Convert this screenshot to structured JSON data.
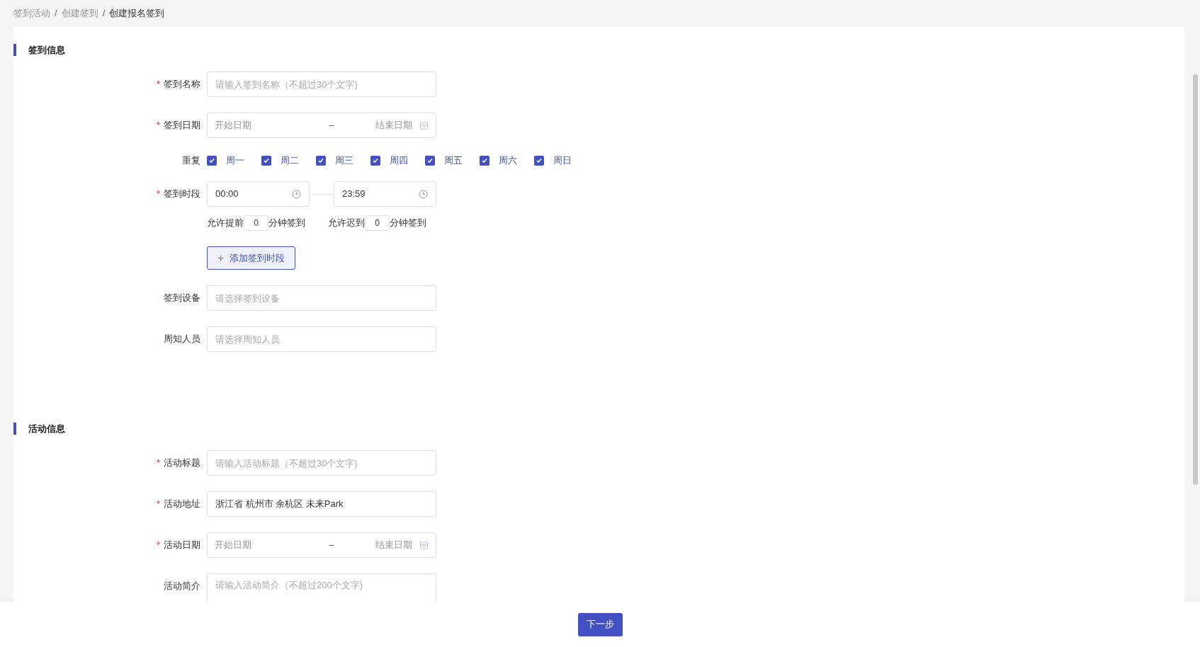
{
  "breadcrumb_separator": "/",
  "required_mark": "*",
  "breadcrumb": [
    {
      "label": "签到活动",
      "current": false
    },
    {
      "label": "创建签到",
      "current": false
    },
    {
      "label": "创建报名签到",
      "current": true
    }
  ],
  "sections": [
    {
      "title": "签到信息",
      "fields": [
        {
          "kind": "text",
          "label": "签到名称",
          "required": true,
          "placeholder": "请输入签到名称（不超过30个文字)"
        },
        {
          "kind": "daterange",
          "label": "签到日期",
          "required": true,
          "start_placeholder": "开始日期",
          "separator": "–",
          "end_placeholder": "结束日期"
        },
        {
          "kind": "weekdays",
          "label": "重复",
          "required": false,
          "options": [
            {
              "label": "周一",
              "checked": true
            },
            {
              "label": "周二",
              "checked": true
            },
            {
              "label": "周三",
              "checked": true
            },
            {
              "label": "周四",
              "checked": true
            },
            {
              "label": "周五",
              "checked": true
            },
            {
              "label": "周六",
              "checked": true
            },
            {
              "label": "周日",
              "checked": true
            }
          ]
        },
        {
          "kind": "timerange",
          "label": "签到时段",
          "required": true,
          "start": "00:00",
          "end": "23:59",
          "early": {
            "before": "允许提前",
            "value": "0",
            "after": "分钟签到"
          },
          "late": {
            "before": "允许迟到",
            "value": "0",
            "after": "分钟签到"
          }
        },
        {
          "kind": "add_button",
          "icon": "+",
          "text": "添加签到时段"
        },
        {
          "kind": "text",
          "label": "签到设备",
          "required": false,
          "placeholder": "请选择签到设备"
        },
        {
          "kind": "text",
          "label": "周知人员",
          "required": false,
          "placeholder": "请选择周知人员"
        }
      ]
    },
    {
      "title": "活动信息",
      "fields": [
        {
          "kind": "text",
          "label": "活动标题",
          "required": true,
          "placeholder": "请输入活动标题（不超过30个文字)"
        },
        {
          "kind": "text",
          "label": "活动地址",
          "required": true,
          "value": "浙江省 杭州市 余杭区 未来Park"
        },
        {
          "kind": "daterange",
          "label": "活动日期",
          "required": true,
          "start_placeholder": "开始日期",
          "separator": "–",
          "end_placeholder": "结束日期"
        },
        {
          "kind": "textarea",
          "label": "活动简介",
          "required": false,
          "placeholder": "请输入活动简介（不超过200个文字)"
        }
      ]
    }
  ],
  "footer": {
    "next_button": "下一步"
  }
}
